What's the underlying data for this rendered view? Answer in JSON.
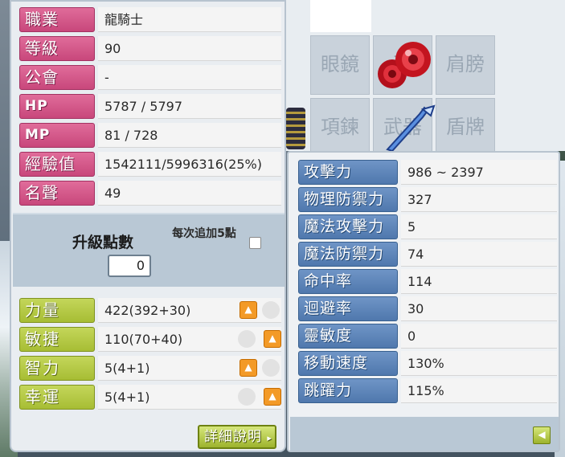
{
  "info": [
    {
      "label": "職業",
      "value": "龍騎士"
    },
    {
      "label": "等級",
      "value": "90"
    },
    {
      "label": "公會",
      "value": "-"
    },
    {
      "label": "HP",
      "value": "5787 / 5797"
    },
    {
      "label": "MP",
      "value": "81 / 728"
    },
    {
      "label": "經驗值",
      "value": "1542111/5996316(25%)"
    },
    {
      "label": "名聲",
      "value": "49"
    }
  ],
  "ability_points": {
    "title": "升級點數",
    "value": "0",
    "auto_assign_label": "每次追加5點"
  },
  "base_stats": [
    {
      "label": "力量",
      "value": "422(392+30)",
      "up_icon": "plus-arrow-icon"
    },
    {
      "label": "敏捷",
      "value": "110(70+40)",
      "up_icon": "plus-arrow-icon"
    },
    {
      "label": "智力",
      "value": "5(4+1)",
      "up_icon": "plus-arrow-icon"
    },
    {
      "label": "幸運",
      "value": "5(4+1)",
      "up_icon": "plus-arrow-icon"
    }
  ],
  "detail_button_label": "詳細說明",
  "equipment_slots": [
    {
      "label": "眼鏡"
    },
    {
      "label": "耳"
    },
    {
      "label": "肩膀"
    },
    {
      "label": "項鍊"
    },
    {
      "label": "武器"
    },
    {
      "label": "盾牌"
    }
  ],
  "detail_stats": [
    {
      "label": "攻擊力",
      "value": "986 ~ 2397"
    },
    {
      "label": "物理防禦力",
      "value": "327"
    },
    {
      "label": "魔法攻擊力",
      "value": "5"
    },
    {
      "label": "魔法防禦力",
      "value": "74"
    },
    {
      "label": "命中率",
      "value": "114"
    },
    {
      "label": "迴避率",
      "value": "30"
    },
    {
      "label": "靈敏度",
      "value": "0"
    },
    {
      "label": "移動速度",
      "value": "130%"
    },
    {
      "label": "跳躍力",
      "value": "115%"
    }
  ],
  "colors": {
    "info_label": "#d65a8c",
    "base_label": "#b6c945",
    "detail_label": "#5f86ba",
    "up_button": "#f39a27"
  }
}
